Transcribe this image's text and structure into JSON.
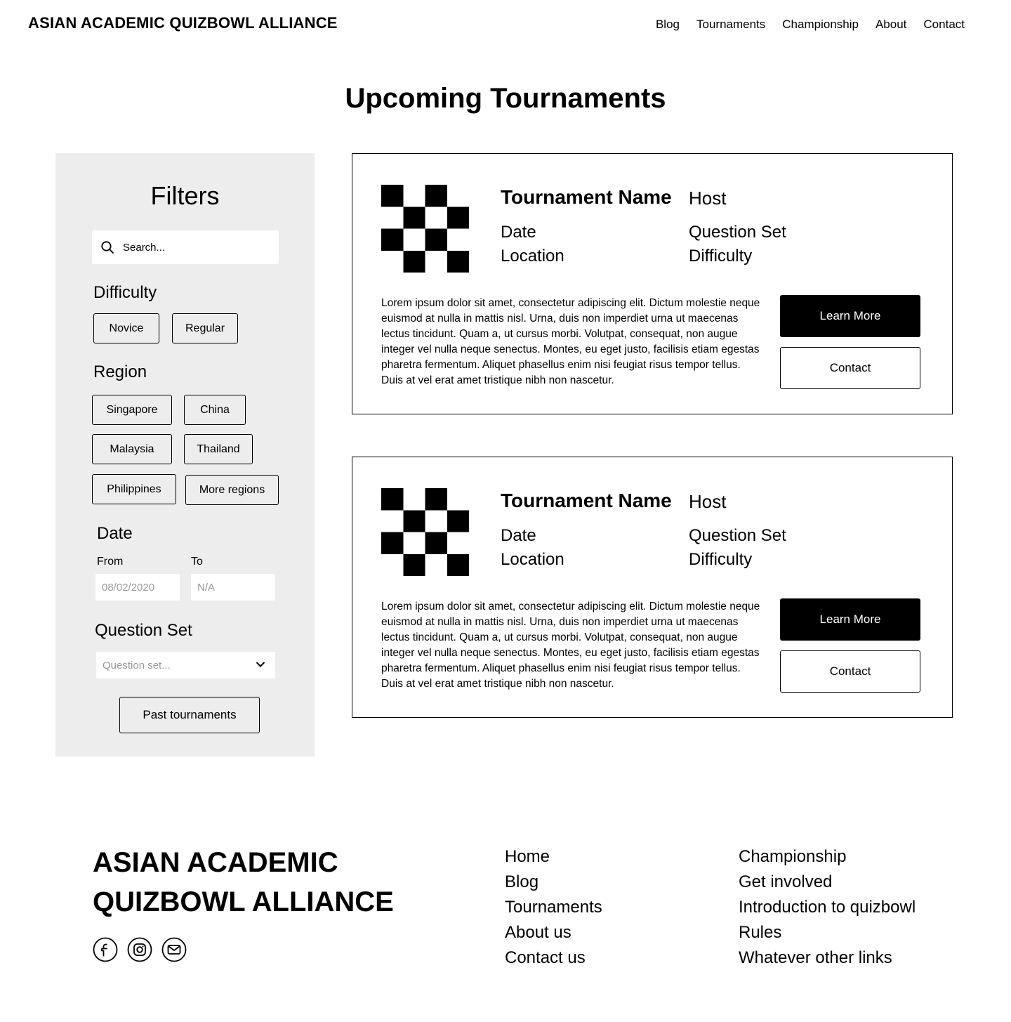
{
  "header": {
    "site_title": "ASIAN ACADEMIC QUIZBOWL ALLIANCE",
    "nav": [
      "Blog",
      "Tournaments",
      "Championship",
      "About",
      "Contact"
    ]
  },
  "page_title": "Upcoming Tournaments",
  "filters": {
    "title": "Filters",
    "search_placeholder": "Search...",
    "difficulty": {
      "label": "Difficulty",
      "options": [
        "Novice",
        "Regular"
      ]
    },
    "region": {
      "label": "Region",
      "options": [
        "Singapore",
        "China",
        "Malaysia",
        "Thailand",
        "Philippines",
        "More regions"
      ]
    },
    "date": {
      "label": "Date",
      "from_label": "From",
      "to_label": "To",
      "from_placeholder": "08/02/2020",
      "to_placeholder": "N/A"
    },
    "question_set": {
      "label": "Question Set",
      "placeholder": "Question set..."
    },
    "past_button": "Past tournaments"
  },
  "tournaments": [
    {
      "name": "Tournament Name",
      "host": "Host",
      "date": "Date",
      "location": "Location",
      "question_set": "Question Set",
      "difficulty": "Difficulty",
      "description": "Lorem ipsum dolor sit amet, consectetur adipiscing elit. Dictum molestie neque euismod at nulla in mattis nisl. Urna, duis non imperdiet urna ut maecenas lectus tincidunt. Quam a, ut cursus morbi. Volutpat, consequat, non augue integer vel nulla neque senectus. Montes, eu eget justo, facilisis etiam egestas pharetra fermentum. Aliquet phasellus enim nisi feugiat risus tempor tellus. Duis at vel erat amet tristique nibh non nascetur.",
      "learn_more": "Learn More",
      "contact": "Contact"
    },
    {
      "name": "Tournament Name",
      "host": "Host",
      "date": "Date",
      "location": "Location",
      "question_set": "Question Set",
      "difficulty": "Difficulty",
      "description": "Lorem ipsum dolor sit amet, consectetur adipiscing elit. Dictum molestie neque euismod at nulla in mattis nisl. Urna, duis non imperdiet urna ut maecenas lectus tincidunt. Quam a, ut cursus morbi. Volutpat, consequat, non augue integer vel nulla neque senectus. Montes, eu eget justo, facilisis etiam egestas pharetra fermentum. Aliquet phasellus enim nisi feugiat risus tempor tellus. Duis at vel erat amet tristique nibh non nascetur.",
      "learn_more": "Learn More",
      "contact": "Contact"
    }
  ],
  "footer": {
    "title": "ASIAN ACADEMIC QUIZBOWL ALLIANCE",
    "socials": [
      "facebook-icon",
      "instagram-icon",
      "mail-icon"
    ],
    "links_col1": [
      "Home",
      "Blog",
      "Tournaments",
      "About us",
      "Contact us"
    ],
    "links_col2": [
      "Championship",
      "Get involved",
      "Introduction to quizbowl",
      "Rules",
      "Whatever other links"
    ]
  }
}
